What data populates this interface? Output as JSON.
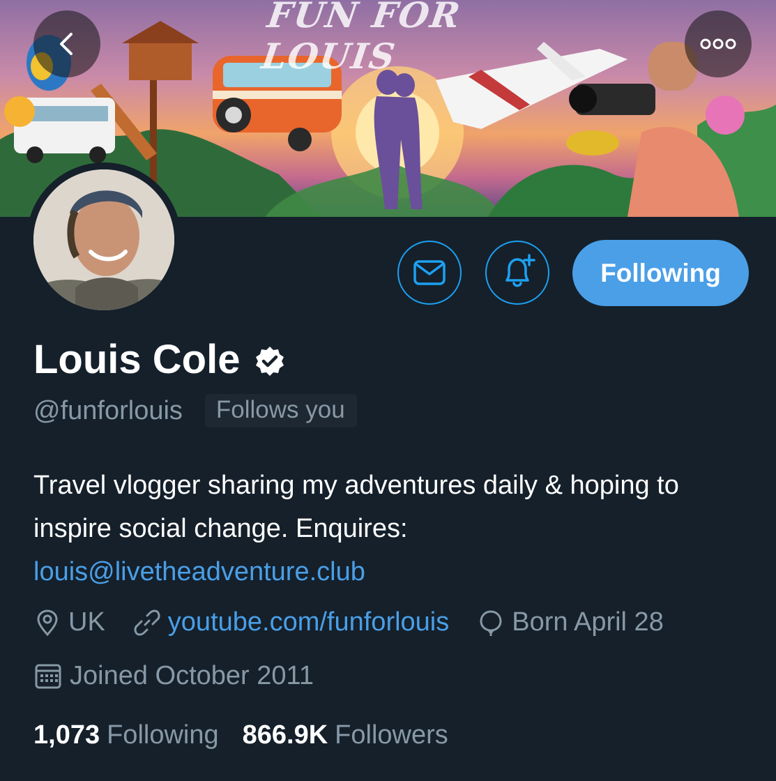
{
  "banner": {
    "title": "FUN FOR LOUIS"
  },
  "header": {
    "back_icon": "chevron-left-icon",
    "more_icon": "more-horizontal-icon"
  },
  "actions": {
    "message_icon": "mail-icon",
    "notify_icon": "bell-plus-icon",
    "following_label": "Following"
  },
  "profile": {
    "name": "Louis Cole",
    "verified": true,
    "handle": "@funforlouis",
    "follows_you": "Follows you",
    "bio_text": "Travel vlogger sharing my adventures daily & hoping to inspire social change. Enquires:",
    "bio_email": "louis@livetheadventure.club",
    "location": "UK",
    "website": "youtube.com/funforlouis",
    "birthday": "Born April 28",
    "joined": "Joined October 2011"
  },
  "stats": {
    "following_count": "1,073",
    "following_label": "Following",
    "followers_count": "866.9K",
    "followers_label": "Followers"
  },
  "colors": {
    "background": "#15202b",
    "accent": "#1da1f2",
    "button_fill": "#4a9fe7",
    "secondary_text": "#8899a6"
  }
}
